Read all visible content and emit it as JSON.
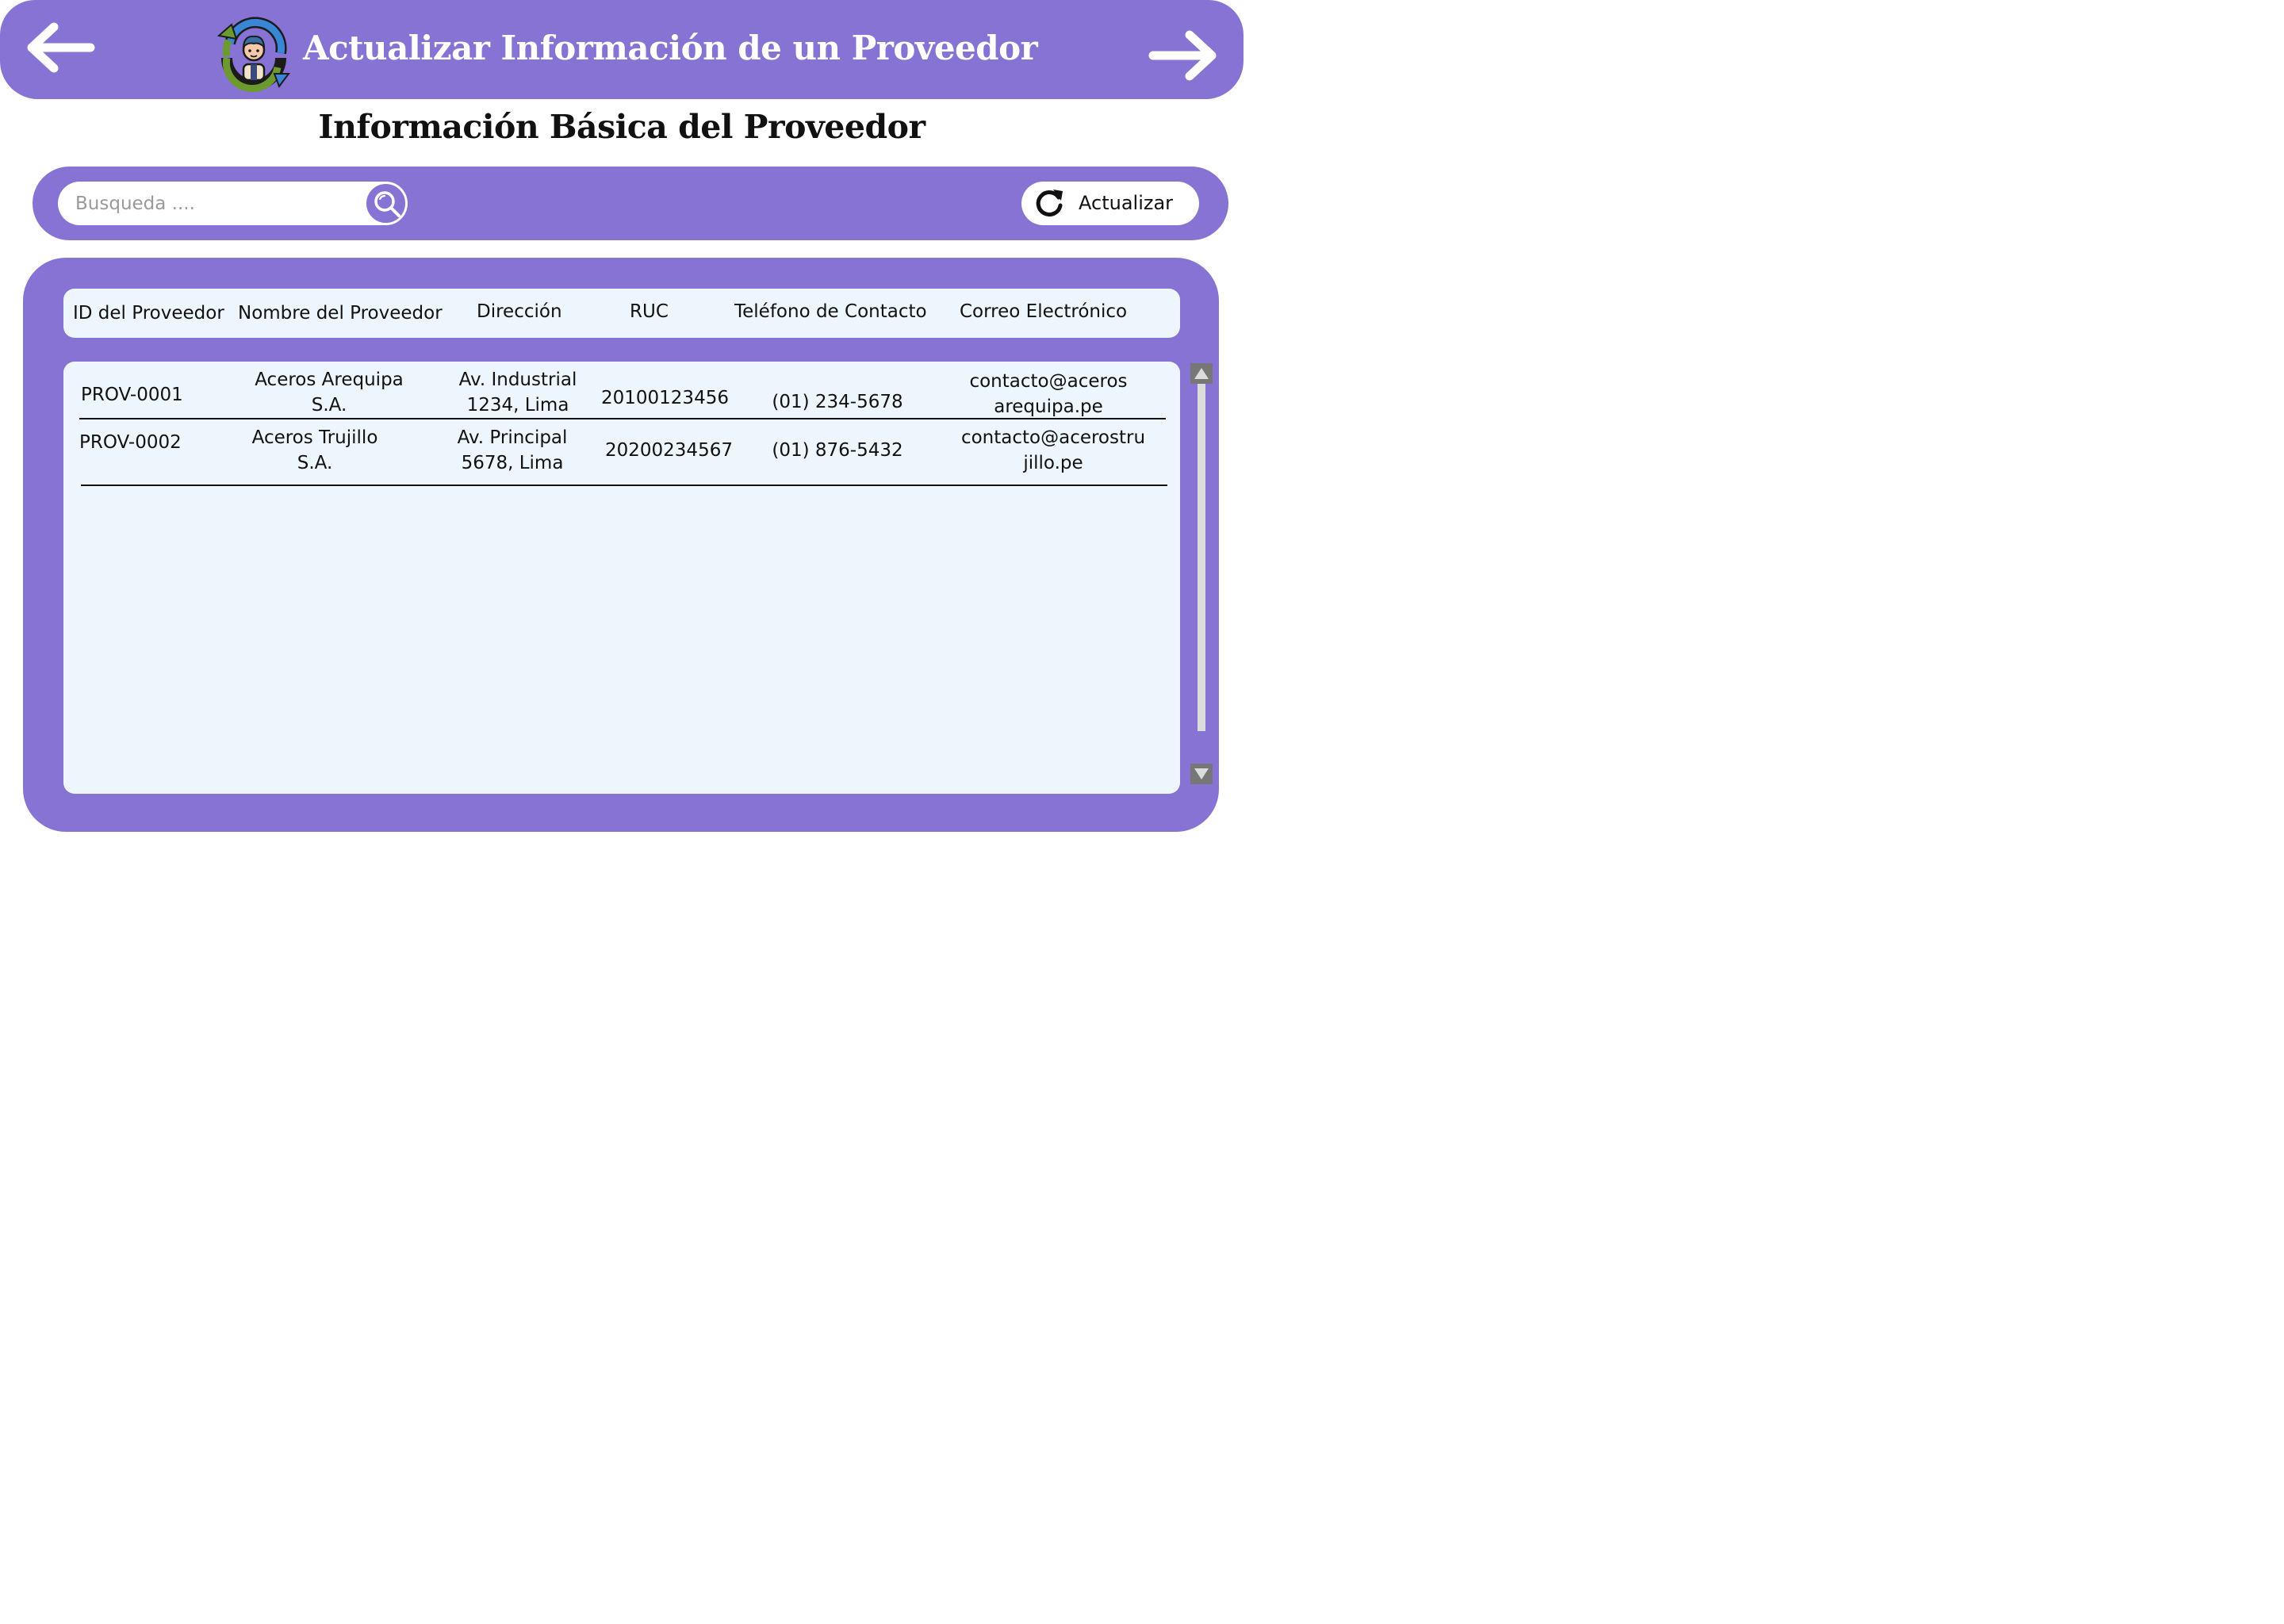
{
  "header": {
    "title": "Actualizar Información de un Proveedor",
    "back_icon": "arrow-left-icon",
    "forward_icon": "arrow-right-icon",
    "logo_icon": "supplier-refresh-logo"
  },
  "section": {
    "title": "Información Básica del Proveedor"
  },
  "toolbar": {
    "search_placeholder": "Busqueda ....",
    "search_icon": "search-icon",
    "refresh_label": "Actualizar",
    "refresh_icon": "refresh-icon"
  },
  "table": {
    "columns": [
      "ID del Proveedor",
      "Nombre del Proveedor",
      "Dirección",
      "RUC",
      "Teléfono de Contacto",
      "Correo Electrónico"
    ],
    "rows": [
      {
        "id": "PROV-0001",
        "name_line1": "Aceros Arequipa",
        "name_line2": "S.A.",
        "address_line1": "Av. Industrial",
        "address_line2": "1234, Lima",
        "ruc": "20100123456",
        "phone": "(01) 234-5678",
        "email_line1": "contacto@aceros",
        "email_line2": "arequipa.pe"
      },
      {
        "id": "PROV-0002",
        "name_line1": "Aceros Trujillo",
        "name_line2": "S.A.",
        "address_line1": "Av. Principal",
        "address_line2": "5678, Lima",
        "ruc": "20200234567",
        "phone": "(01) 876-5432",
        "email_line1": "contacto@acerostru",
        "email_line2": "jillo.pe"
      }
    ]
  },
  "colors": {
    "primary": "#8773d4",
    "panel_bg": "#eef6fd",
    "text": "#111111"
  }
}
